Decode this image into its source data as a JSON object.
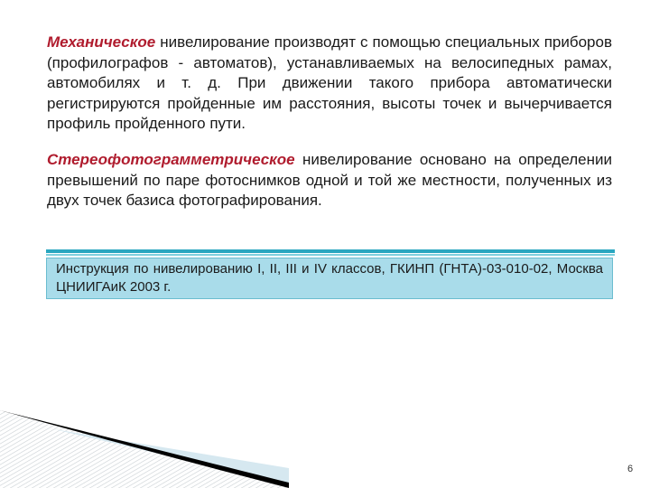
{
  "slide": {
    "paragraph1": {
      "emphasis": "Механическое",
      "text": " нивелирование производят с помощью специальных приборов (профилографов - автоматов), устанавливаемых на велосипедных рамах, автомобилях и т. д. При движении такого прибора автоматически регистрируются пройденные им расстояния, высоты точек и вычерчивается профиль пройденного пути."
    },
    "paragraph2": {
      "emphasis": "Стереофотограмметрическое",
      "text": " нивелирование основано на определении превышений по паре фотоснимков одной и той же местности, полученных из двух точек базиса фотографирования."
    },
    "reference": "Инструкция по нивелированию I, II, III и IV классов, ГКИНП (ГНТА)-03-010-02, Москва ЦНИИГАиК 2003 г.",
    "page_number": "6"
  },
  "colors": {
    "emphasis": "#b01c2e",
    "accent_rule": "#2aa7c0",
    "reference_box": "#a9dcea"
  }
}
